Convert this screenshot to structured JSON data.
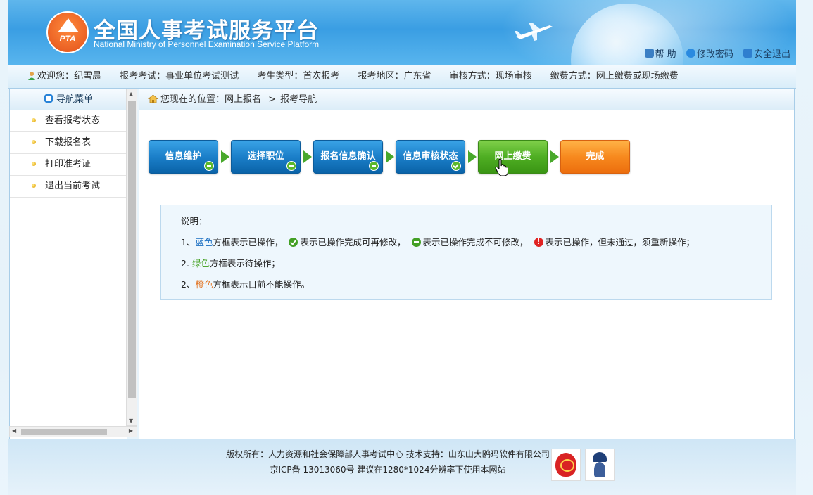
{
  "header": {
    "title": "全国人事考试服务平台",
    "subtitle": "National Ministry of Personnel Examination Service Platform",
    "logo_text": "PTA",
    "links": {
      "help": "帮 助",
      "change_password": "修改密码",
      "logout": "安全退出"
    }
  },
  "infobar": {
    "welcome": "欢迎您：纪雪晨",
    "exam": "报考考试：事业单位考试测试",
    "candidate_type": "考生类型：首次报考",
    "region": "报考地区：广东省",
    "review_mode": "审核方式：现场审核",
    "payment_mode": "缴费方式：网上缴费或现场缴费"
  },
  "sidebar": {
    "title": "导航菜单",
    "items": [
      {
        "label": "查看报考状态"
      },
      {
        "label": "下载报名表"
      },
      {
        "label": "打印准考证"
      },
      {
        "label": "退出当前考试"
      }
    ]
  },
  "breadcrumb": {
    "prefix": "您现在的位置：",
    "path1": "网上报名",
    "sep": ">",
    "path2": "报考导航"
  },
  "steps": [
    {
      "label": "信息维护",
      "color": "blue",
      "status": "minus"
    },
    {
      "label": "选择职位",
      "color": "blue",
      "status": "minus"
    },
    {
      "label": "报名信息确认",
      "color": "blue",
      "status": "minus"
    },
    {
      "label": "信息审核状态",
      "color": "blue",
      "status": "check"
    },
    {
      "label": "网上缴费",
      "color": "green",
      "status": ""
    },
    {
      "label": "完成",
      "color": "orange",
      "status": ""
    }
  ],
  "note": {
    "title": "说明：",
    "line1_num": "1、",
    "line1_blue": "蓝色",
    "line1_a": "方框表示已操作，",
    "line1_b": "表示已操作完成可再修改，",
    "line1_c": "表示已操作完成不可修改，",
    "line1_d": "表示已操作，但未通过，须重新操作；",
    "line2_num": "2.  ",
    "line2_green": "绿色",
    "line2_rest": "方框表示待操作；",
    "line3_num": "2、",
    "line3_orange": "橙色",
    "line3_rest": "方框表示目前不能操作。"
  },
  "footer": {
    "line1": "版权所有：人力资源和社会保障部人事考试中心   技术支持：山东山大鸥玛软件有限公司",
    "line2": "京ICP备 13013060号   建议在1280*1024分辨率下使用本网站"
  },
  "colors": {
    "header_blue": "#3a9ee3",
    "step_blue": "#1b7fc9",
    "step_green": "#4fae23",
    "step_orange": "#f7891e",
    "note_blue_text": "#1b6fc2",
    "note_green_text": "#3e9e1a",
    "note_orange_text": "#e2711d"
  }
}
